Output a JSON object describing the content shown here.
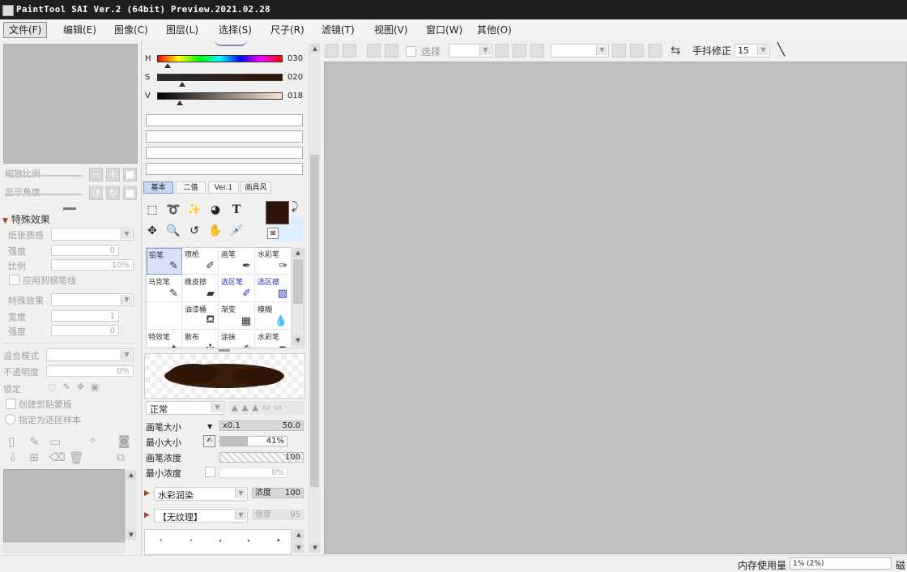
{
  "window": {
    "title": "PaintTool SAI Ver.2 (64bit) Preview.2021.02.28"
  },
  "menu": [
    "文件(F)",
    "编辑(E)",
    "图像(C)",
    "图层(L)",
    "选择(S)",
    "尺子(R)",
    "滤镜(T)",
    "视图(V)",
    "窗口(W)",
    "其他(O)"
  ],
  "left": {
    "zoom_label": "缩放比例",
    "angle_label": "显示角度",
    "effects_header": "特殊效果",
    "paper_texture_label": "纸张质感",
    "strength_label": "强度",
    "strength_value": "0",
    "scale_label": "比例",
    "scale_value": "10%",
    "apply_to_pen_label": "应用到钢笔线",
    "special_effect_label": "特殊效果",
    "width_label": "宽度",
    "width_value": "1",
    "strength2_label": "强度",
    "strength2_value": "0",
    "blend_mode_label": "混合模式",
    "opacity_label": "不透明度",
    "opacity_value": "0%",
    "lock_label": "锁定",
    "clipping_label": "创建剪贴蒙版",
    "selection_source_label": "指定为选区样本"
  },
  "color": {
    "h_label": "H",
    "h_value": "030",
    "s_label": "S",
    "s_value": "020",
    "v_label": "V",
    "v_value": "018",
    "primary": "#2e1508",
    "secondary": "#ddeeff"
  },
  "tool_tabs": [
    "基本",
    "二值",
    "Ver.1",
    "画具风"
  ],
  "brushes": [
    {
      "name": "铅笔",
      "selected": true
    },
    {
      "name": "喷枪"
    },
    {
      "name": "画笔"
    },
    {
      "name": "水彩笔"
    },
    {
      "name": "马克笔"
    },
    {
      "name": "橡皮擦"
    },
    {
      "name": "选区笔",
      "blue": true
    },
    {
      "name": "选区擦",
      "blue": true
    },
    {
      "name": ""
    },
    {
      "name": "油漆桶"
    },
    {
      "name": "渐变"
    },
    {
      "name": "模糊"
    },
    {
      "name": "特效笔"
    },
    {
      "name": "散布"
    },
    {
      "name": "涂抹"
    },
    {
      "name": "水彩笔"
    }
  ],
  "brush_props": {
    "blend": "正常",
    "size_label": "画笔大小",
    "size_mult": "x0.1",
    "size_value": "50.0",
    "min_size_label": "最小大小",
    "min_size_value": "41%",
    "min_size_fraction": 0.41,
    "density_label": "画笔浓度",
    "density_value": "100",
    "min_density_label": "最小浓度",
    "min_density_value": "0%",
    "watercolor": "水彩润染",
    "watercolor_density_label": "浓度",
    "watercolor_density_value": "100",
    "texture": "【无纹理】",
    "texture_strength_label": "强度",
    "texture_strength_value": "95"
  },
  "toolbar": {
    "select_label": "选择",
    "stabilizer_label": "手抖修正",
    "stabilizer_value": "15"
  },
  "status": {
    "memory_label": "内存使用量",
    "memory_value": "1% (2%)",
    "disk_label": "磁"
  }
}
